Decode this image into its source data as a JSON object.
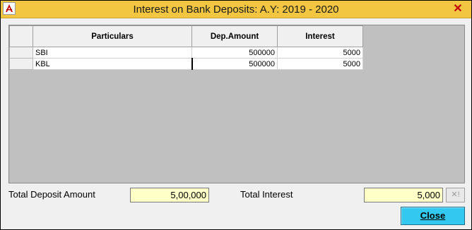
{
  "window": {
    "title": "Interest on Bank Deposits: A.Y: 2019 - 2020",
    "close_glyph": "✕"
  },
  "grid": {
    "columns": [
      "Particulars",
      "Dep.Amount",
      "Interest"
    ],
    "rows": [
      {
        "particulars": "SBI",
        "dep_amount": "500000",
        "interest": "5000"
      },
      {
        "particulars": "KBL",
        "dep_amount": "500000",
        "interest": "5000"
      }
    ]
  },
  "totals": {
    "deposit_label": "Total Deposit Amount",
    "deposit_value": "5,00,000",
    "interest_label": "Total Interest",
    "interest_value": "5,000",
    "clear_glyph": "✕!"
  },
  "buttons": {
    "close_label": "Close"
  },
  "colors": {
    "titlebar": "#f2c640",
    "value_box": "#ffffc8",
    "close_button": "#33c8f0"
  },
  "icons": {
    "app": "app-logo-icon",
    "window_close": "close-icon",
    "clear": "clear-icon"
  }
}
